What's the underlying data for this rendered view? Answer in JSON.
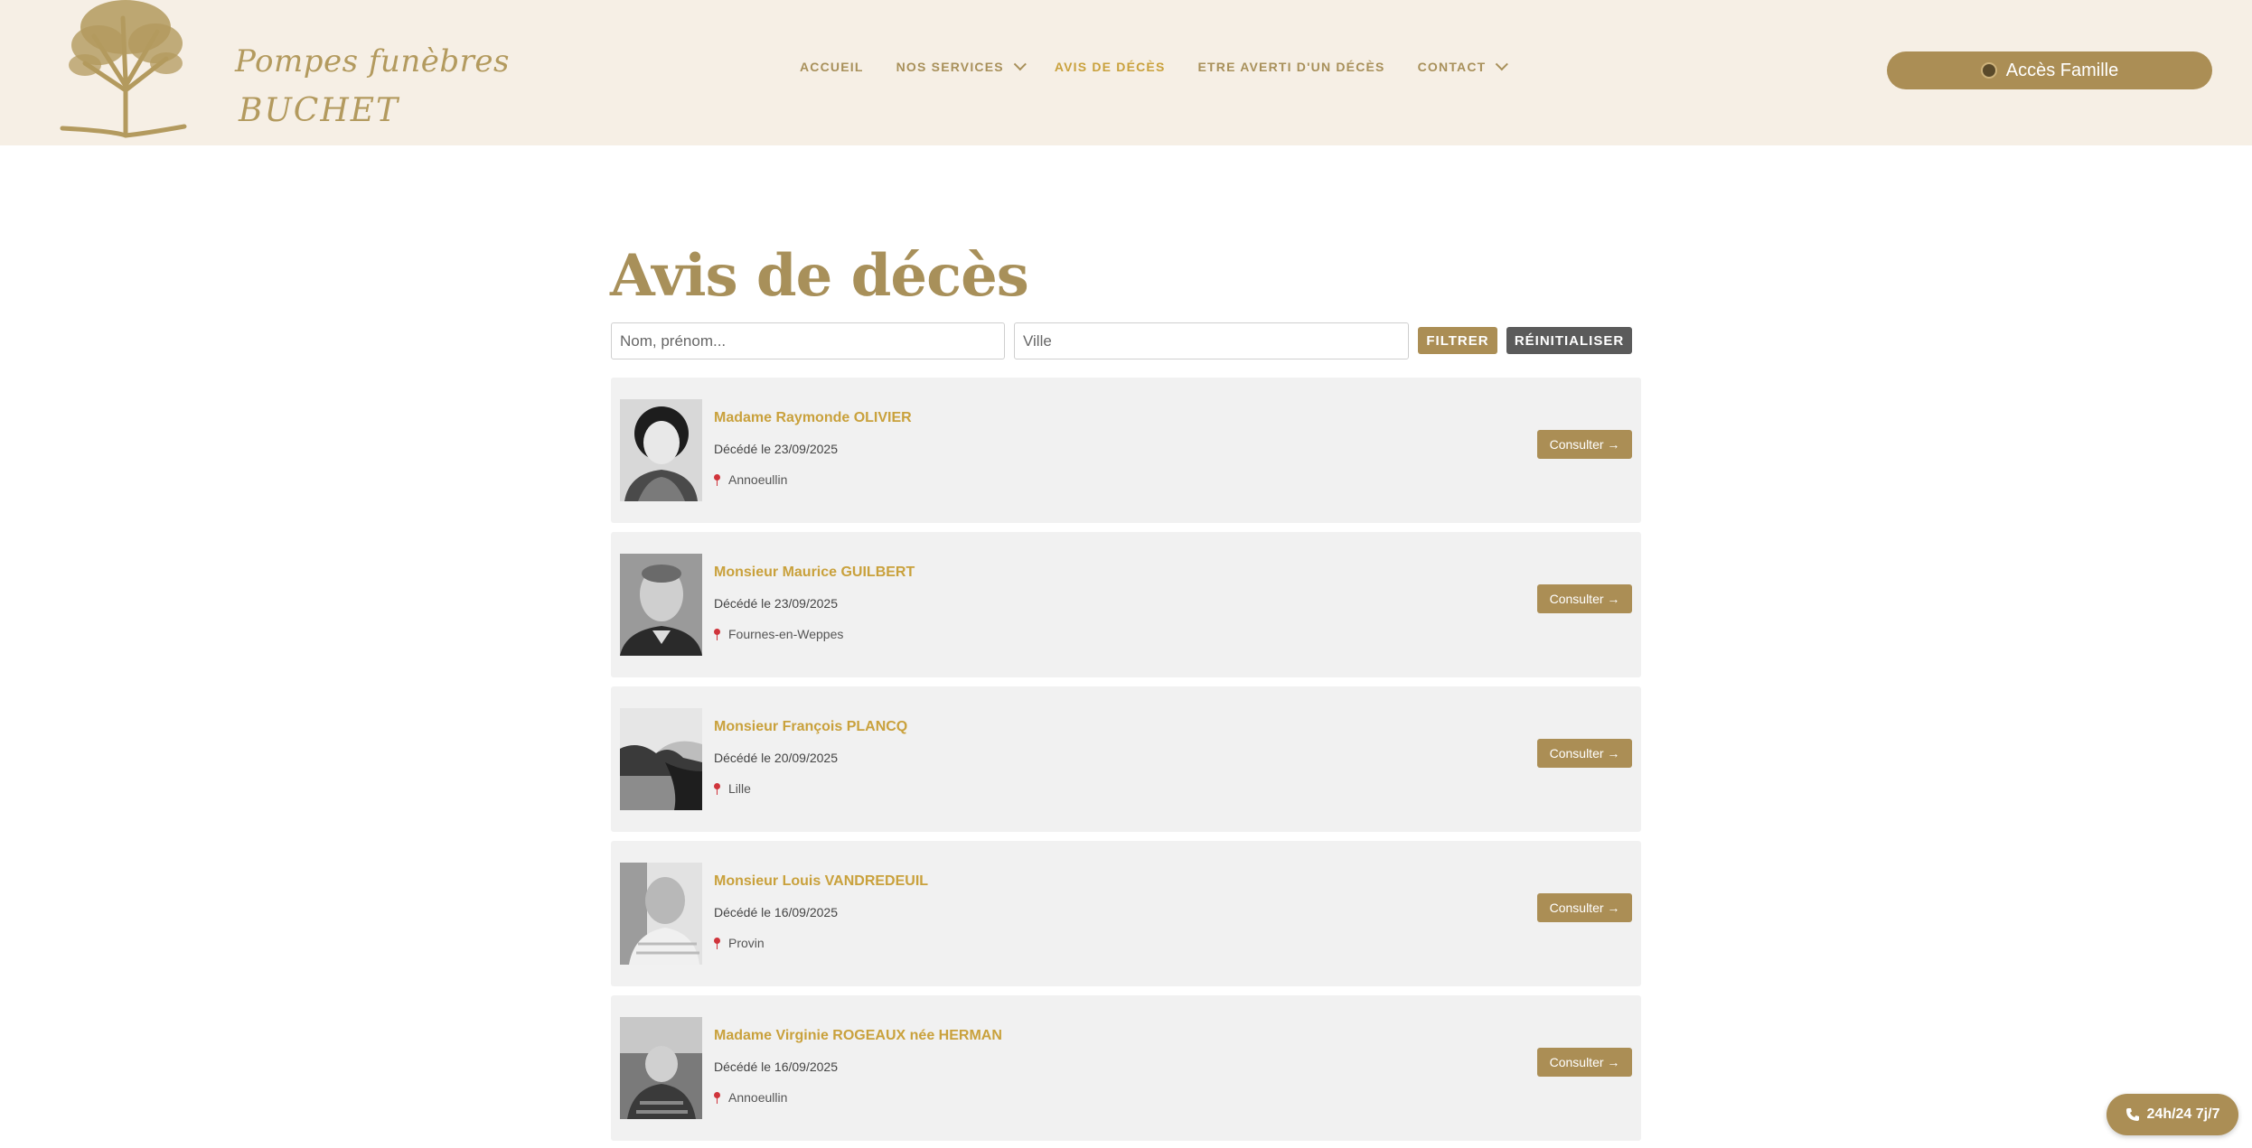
{
  "header": {
    "logo_line1": "Pompes funèbres",
    "logo_line2": "BUCHET",
    "nav": [
      {
        "label": "ACCUEIL",
        "dropdown": false,
        "active": false
      },
      {
        "label": "NOS SERVICES",
        "dropdown": true,
        "active": false
      },
      {
        "label": "AVIS DE DÉCÈS",
        "dropdown": false,
        "active": true
      },
      {
        "label": "ETRE AVERTI D'UN DÉCÈS",
        "dropdown": false,
        "active": false
      },
      {
        "label": "CONTACT",
        "dropdown": true,
        "active": false
      }
    ],
    "access_button": "Accès Famille"
  },
  "main": {
    "title": "Avis de décès",
    "filters": {
      "name_placeholder": "Nom, prénom...",
      "city_placeholder": "Ville",
      "filter_label": "FILTRER",
      "reset_label": "RÉINITIALISER"
    },
    "notices": [
      {
        "name": "Madame Raymonde OLIVIER",
        "date": "Décédé le 23/09/2025",
        "city": "Annoeullin",
        "button": "Consulter →"
      },
      {
        "name": "Monsieur Maurice GUILBERT",
        "date": "Décédé le 23/09/2025",
        "city": "Fournes-en-Weppes",
        "button": "Consulter →"
      },
      {
        "name": "Monsieur François PLANCQ",
        "date": "Décédé le 20/09/2025",
        "city": "Lille",
        "button": "Consulter →"
      },
      {
        "name": "Monsieur Louis VANDREDEUIL",
        "date": "Décédé le 16/09/2025",
        "city": "Provin",
        "button": "Consulter →"
      },
      {
        "name": "Madame Virginie ROGEAUX née HERMAN",
        "date": "Décédé le 16/09/2025",
        "city": "Annoeullin",
        "button": "Consulter →"
      }
    ]
  },
  "floating": {
    "phone_label": "24h/24 7j/7"
  },
  "colors": {
    "header_bg": "#f6efe5",
    "gold": "#ab8e55",
    "nav_active": "#c9a13c",
    "card_bg": "#f1f1f1",
    "reset_bg": "#5b5b5b"
  }
}
